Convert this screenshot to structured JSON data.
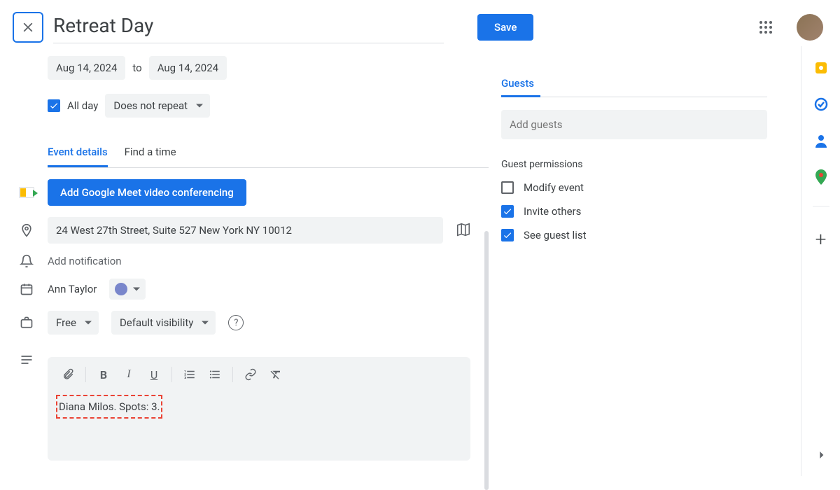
{
  "header": {
    "title": "Retreat Day",
    "save_label": "Save"
  },
  "dates": {
    "start": "Aug 14, 2024",
    "to_label": "to",
    "end": "Aug 14, 2024",
    "all_day_label": "All day",
    "all_day_checked": true,
    "recurrence": "Does not repeat"
  },
  "tabs": {
    "event_details": "Event details",
    "find_a_time": "Find a time"
  },
  "details": {
    "meet_button": "Add Google Meet video conferencing",
    "location": "24 West 27th Street, Suite 527 New York NY 10012",
    "notification": "Add notification",
    "owner": "Ann Taylor",
    "calendar_color": "#7986cb",
    "availability": "Free",
    "visibility": "Default visibility"
  },
  "description": {
    "text": "Diana Milos. Spots: 3."
  },
  "guests": {
    "heading": "Guests",
    "add_placeholder": "Add guests",
    "permissions_heading": "Guest permissions",
    "modify_label": "Modify event",
    "modify_checked": false,
    "invite_label": "Invite others",
    "invite_checked": true,
    "see_label": "See guest list",
    "see_checked": true
  },
  "side_panel": {
    "icons": [
      "keep-icon",
      "tasks-icon",
      "contacts-icon",
      "maps-icon"
    ]
  }
}
